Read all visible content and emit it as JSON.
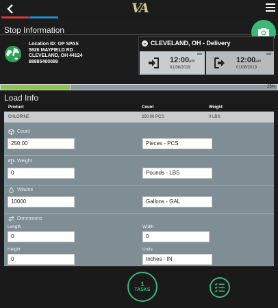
{
  "header": {
    "logo_text": "VA"
  },
  "stop": {
    "section_title": "Stop Information",
    "location_id": "Location ID: OP SPAS",
    "address_line1": "5826 MAYFIELD RD",
    "address_line2": "CLEVELAND, OH 44124",
    "phone": "88885400099",
    "delivery_title": "CLEVELAND, OH - Delivery",
    "arrive": {
      "est": "EST",
      "time": "12:00",
      "ampm": "am",
      "date": "01/08/2019"
    },
    "depart": {
      "est": "EST",
      "time": "12:00",
      "ampm": "am",
      "date": "01/08/2019"
    }
  },
  "progress": {
    "value": 0.25,
    "label": "25%"
  },
  "load": {
    "section_title": "Load Info",
    "columns": [
      "Product",
      "Count",
      "Weight"
    ],
    "row": [
      "CHLORINE",
      "250.00 PCS",
      "0 LBS"
    ],
    "count": {
      "label": "Count",
      "value": "250.00",
      "unit": "Pieces - PCS"
    },
    "weight": {
      "label": "Weight",
      "value": "0",
      "unit": "Pounds - LBS"
    },
    "volume": {
      "label": "Volume",
      "value": "10000",
      "unit": "Gallons - GAL"
    },
    "dimensions": {
      "label": "Dimensions",
      "length_label": "Length",
      "length_value": "0",
      "width_label": "Width",
      "width_value": "0",
      "height_label": "Height",
      "height_value": "0",
      "units_label": "Units",
      "units_value": "Inches - IN"
    }
  },
  "footer": {
    "tasks_count": "1",
    "tasks_label": "TASKS"
  },
  "colors": {
    "accent_green": "#3cb878",
    "progress_green": "#8ac64a",
    "stripe_red": "#d8393b",
    "stripe_blue": "#1f8ed6"
  }
}
